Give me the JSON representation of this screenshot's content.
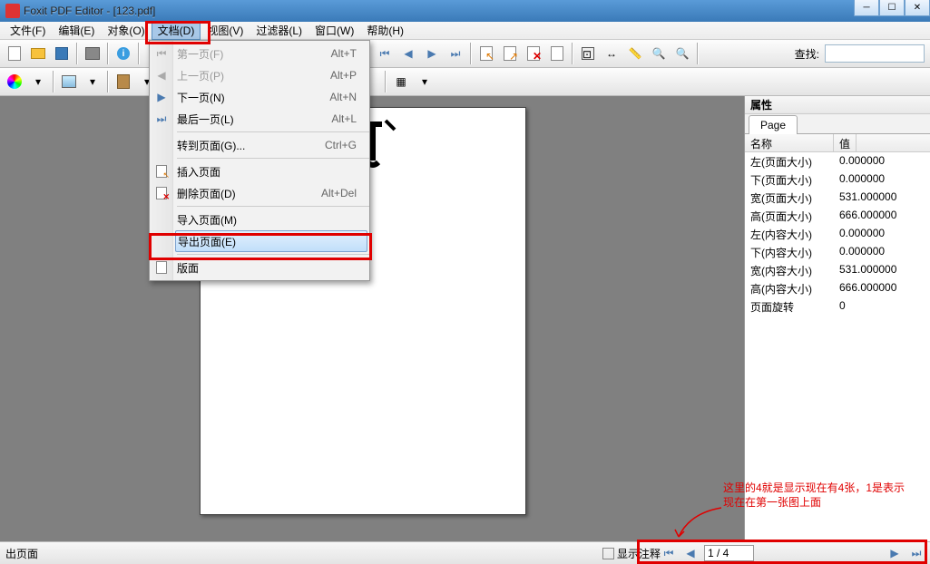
{
  "window": {
    "title": "Foxit PDF Editor - [123.pdf]"
  },
  "menu": {
    "file": "文件(F)",
    "edit": "编辑(E)",
    "object": "对象(O)",
    "document": "文档(D)",
    "view": "视图(V)",
    "filter": "过滤器(L)",
    "window": "窗口(W)",
    "help": "帮助(H)"
  },
  "dropdown": {
    "first_page": {
      "label": "第一页(F)",
      "shortcut": "Alt+T"
    },
    "prev_page": {
      "label": "上一页(P)",
      "shortcut": "Alt+P"
    },
    "next_page": {
      "label": "下一页(N)",
      "shortcut": "Alt+N"
    },
    "last_page": {
      "label": "最后一页(L)",
      "shortcut": "Alt+L"
    },
    "goto_page": {
      "label": "转到页面(G)...",
      "shortcut": "Ctrl+G"
    },
    "insert_page": {
      "label": "插入页面"
    },
    "delete_page": {
      "label": "删除页面(D)",
      "shortcut": "Alt+Del"
    },
    "import_page": {
      "label": "导入页面(M)"
    },
    "export_page": {
      "label": "导出页面(E)"
    },
    "layout": {
      "label": "版面"
    }
  },
  "search_label": "查找:",
  "properties": {
    "title": "属性",
    "tab": "Page",
    "headers": {
      "name": "名称",
      "value": "值"
    },
    "rows": [
      {
        "name": "左(页面大小)",
        "value": "0.000000"
      },
      {
        "name": "下(页面大小)",
        "value": "0.000000"
      },
      {
        "name": "宽(页面大小)",
        "value": "531.000000"
      },
      {
        "name": "高(页面大小)",
        "value": "666.000000"
      },
      {
        "name": "左(内容大小)",
        "value": "0.000000"
      },
      {
        "name": "下(内容大小)",
        "value": "0.000000"
      },
      {
        "name": "宽(内容大小)",
        "value": "531.000000"
      },
      {
        "name": "高(内容大小)",
        "value": "666.000000"
      },
      {
        "name": "页面旋转",
        "value": "0"
      }
    ]
  },
  "statusbar": {
    "export_page": "出页面",
    "show_annot": "显示注释",
    "page_nav": "1 / 4"
  },
  "annotation": {
    "line1": "这里的4就是显示现在有4张，1是表示",
    "line2": "现在在第一张图上面"
  },
  "colors": {
    "accent": "#3a7ab8",
    "highlight_border": "#e00000"
  }
}
